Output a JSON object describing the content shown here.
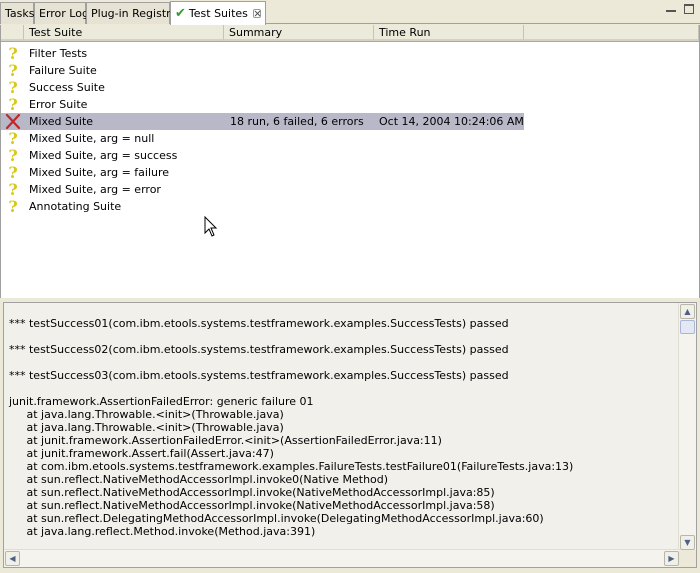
{
  "tabs": [
    {
      "label": "Tasks"
    },
    {
      "label": "Error Log"
    },
    {
      "label": "Plug-in Registry"
    },
    {
      "label": "Test Suites",
      "active": true
    }
  ],
  "table": {
    "columns": [
      "Test Suite",
      "Summary",
      "Time Run"
    ],
    "rows": [
      {
        "status": "unknown",
        "name": "Filter Tests",
        "summary": "",
        "time": ""
      },
      {
        "status": "unknown",
        "name": "Failure Suite",
        "summary": "",
        "time": ""
      },
      {
        "status": "unknown",
        "name": "Success Suite",
        "summary": "",
        "time": ""
      },
      {
        "status": "unknown",
        "name": "Error Suite",
        "summary": "",
        "time": ""
      },
      {
        "status": "failed",
        "name": "Mixed Suite",
        "summary": "18 run, 6 failed, 6 errors",
        "time": "Oct 14, 2004 10:24:06 AM",
        "selected": true
      },
      {
        "status": "unknown",
        "name": "Mixed Suite, arg = null",
        "summary": "",
        "time": ""
      },
      {
        "status": "unknown",
        "name": "Mixed Suite, arg = success",
        "summary": "",
        "time": ""
      },
      {
        "status": "unknown",
        "name": "Mixed Suite, arg = failure",
        "summary": "",
        "time": ""
      },
      {
        "status": "unknown",
        "name": "Mixed Suite, arg = error",
        "summary": "",
        "time": ""
      },
      {
        "status": "unknown",
        "name": "Annotating Suite",
        "summary": "",
        "time": ""
      }
    ]
  },
  "console": {
    "lines": [
      "*** testSuccess01(com.ibm.etools.systems.testframework.examples.SuccessTests) passed",
      "",
      "*** testSuccess02(com.ibm.etools.systems.testframework.examples.SuccessTests) passed",
      "",
      "*** testSuccess03(com.ibm.etools.systems.testframework.examples.SuccessTests) passed",
      "",
      "junit.framework.AssertionFailedError: generic failure 01",
      "     at java.lang.Throwable.<init>(Throwable.java)",
      "     at java.lang.Throwable.<init>(Throwable.java)",
      "     at junit.framework.AssertionFailedError.<init>(AssertionFailedError.java:11)",
      "     at junit.framework.Assert.fail(Assert.java:47)",
      "     at com.ibm.etools.systems.testframework.examples.FailureTests.testFailure01(FailureTests.java:13)",
      "     at sun.reflect.NativeMethodAccessorImpl.invoke0(Native Method)",
      "     at sun.reflect.NativeMethodAccessorImpl.invoke(NativeMethodAccessorImpl.java:85)",
      "     at sun.reflect.NativeMethodAccessorImpl.invoke(NativeMethodAccessorImpl.java:58)",
      "     at sun.reflect.DelegatingMethodAccessorImpl.invoke(DelegatingMethodAccessorImpl.java:60)",
      "     at java.lang.reflect.Method.invoke(Method.java:391)"
    ]
  },
  "icons": {
    "unknown": "question-mark-icon",
    "failed": "red-x-icon",
    "tab_check": "green-check-icon"
  },
  "colors": {
    "selected_row": "#B8B8C8",
    "question_icon": "#D8C81C",
    "fail_icon": "#C0282C",
    "check": "#2F9E2F"
  }
}
